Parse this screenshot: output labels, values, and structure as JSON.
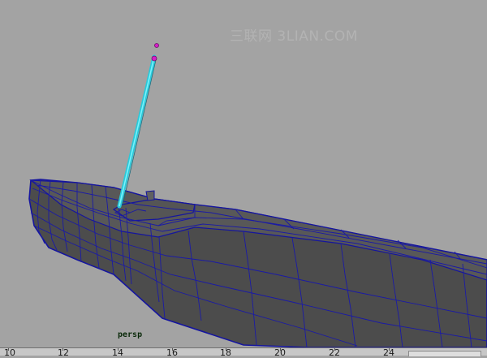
{
  "viewport": {
    "camera_label": "persp",
    "watermark": "三联网 3LIAN.COM",
    "background_color": "#a3a3a3",
    "wire_color": "#1b1ba8",
    "selected_color": "#35d7e6",
    "pivot_color": "#d51fc8"
  },
  "timeline": {
    "frames": [
      "10",
      "12",
      "14",
      "16",
      "18",
      "20",
      "22",
      "24"
    ]
  }
}
